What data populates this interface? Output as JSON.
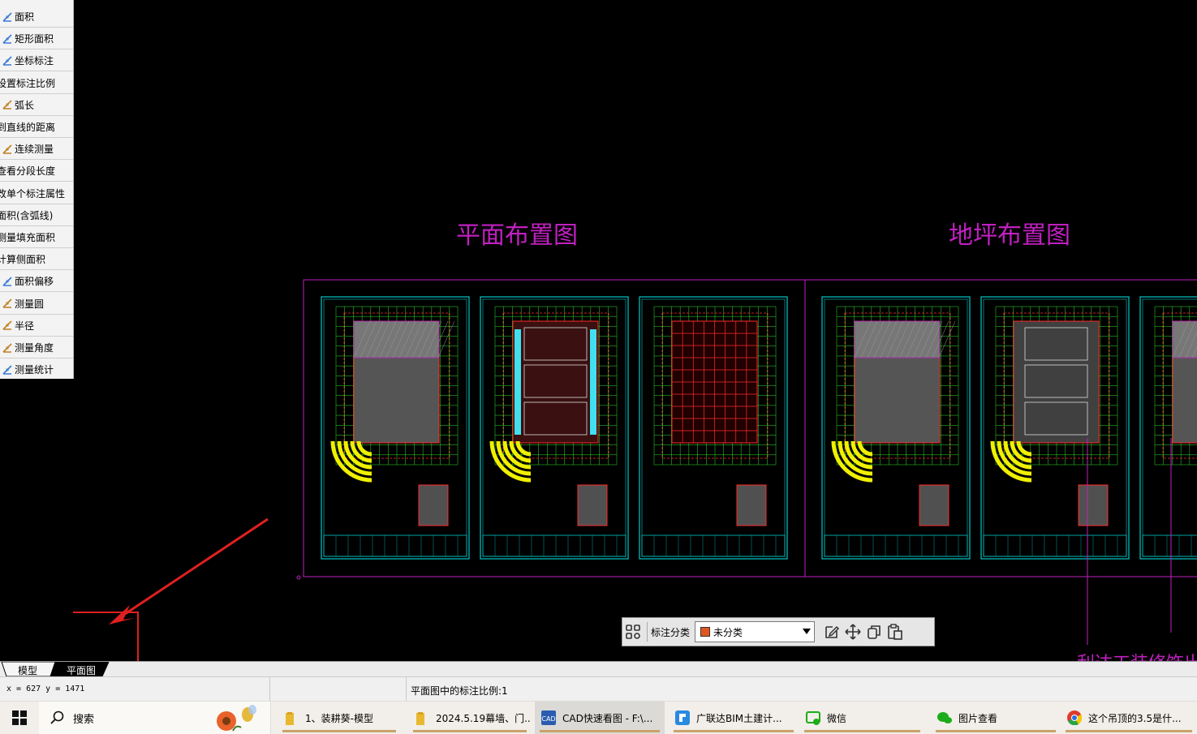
{
  "sidebar": {
    "items": [
      {
        "label": "面积",
        "icon": "area-icon"
      },
      {
        "label": "矩形面积",
        "icon": "rect-area-icon"
      },
      {
        "label": "坐标标注",
        "icon": "coordinate-icon"
      },
      {
        "label": "设置标注比例",
        "icon": "scale-icon"
      },
      {
        "label": "弧长",
        "icon": "arc-length-icon"
      },
      {
        "label": "到直线的距离",
        "icon": "line-distance-icon"
      },
      {
        "label": "连续测量",
        "icon": "continuous-measure-icon"
      },
      {
        "label": "查看分段长度",
        "icon": "segment-length-icon"
      },
      {
        "label": "改单个标注属性",
        "icon": "edit-dimension-icon"
      },
      {
        "label": "面积(含弧线)",
        "icon": "arc-area-icon"
      },
      {
        "label": "测量填充面积",
        "icon": "hatch-area-icon"
      },
      {
        "label": "计算侧面积",
        "icon": "side-area-icon"
      },
      {
        "label": "面积偏移",
        "icon": "area-offset-icon"
      },
      {
        "label": "测量圆",
        "icon": "circle-measure-icon"
      },
      {
        "label": "半径",
        "icon": "radius-icon"
      },
      {
        "label": "测量角度",
        "icon": "angle-icon"
      },
      {
        "label": "测量统计",
        "icon": "statistics-icon"
      }
    ]
  },
  "drawing": {
    "title_left": "平面布置图",
    "title_right": "地坪布置图",
    "partial_text": "一利达工装修饰出"
  },
  "toolbar": {
    "category_label": "标注分类",
    "category_value": "未分类",
    "category_color": "#e0561e",
    "icons": [
      "grid-icon",
      "edit-icon",
      "move-icon",
      "copy-icon",
      "paste-icon"
    ]
  },
  "tabs": {
    "items": [
      "模型",
      "平面图"
    ],
    "active": "平面图"
  },
  "status": {
    "coords": "x = 627  y = 1471",
    "scale_text": "平面图中的标注比例:1"
  },
  "taskbar": {
    "search_label": "搜索",
    "items": [
      {
        "label": "1、装耕葵-模型",
        "icon": "folder-icon"
      },
      {
        "label": "2024.5.19幕墙、门...",
        "icon": "folder-icon"
      },
      {
        "label": "CAD快速看图 - F:\\...",
        "icon": "cad-app-icon"
      },
      {
        "label": "广联达BIM土建计...",
        "icon": "glodon-app-icon"
      },
      {
        "label": "微信",
        "icon": "wechat-icon"
      },
      {
        "label": "图片查看",
        "icon": "wechat-image-icon"
      },
      {
        "label": "这个吊顶的3.5是什...",
        "icon": "chrome-icon"
      }
    ]
  },
  "colors": {
    "frame_magenta": "#c020c0",
    "sheet_cyan": "#00c8c8",
    "grid_green": "#30e030",
    "annotation_red": "#ff2a2a",
    "accent_yellow": "#f0f000"
  }
}
